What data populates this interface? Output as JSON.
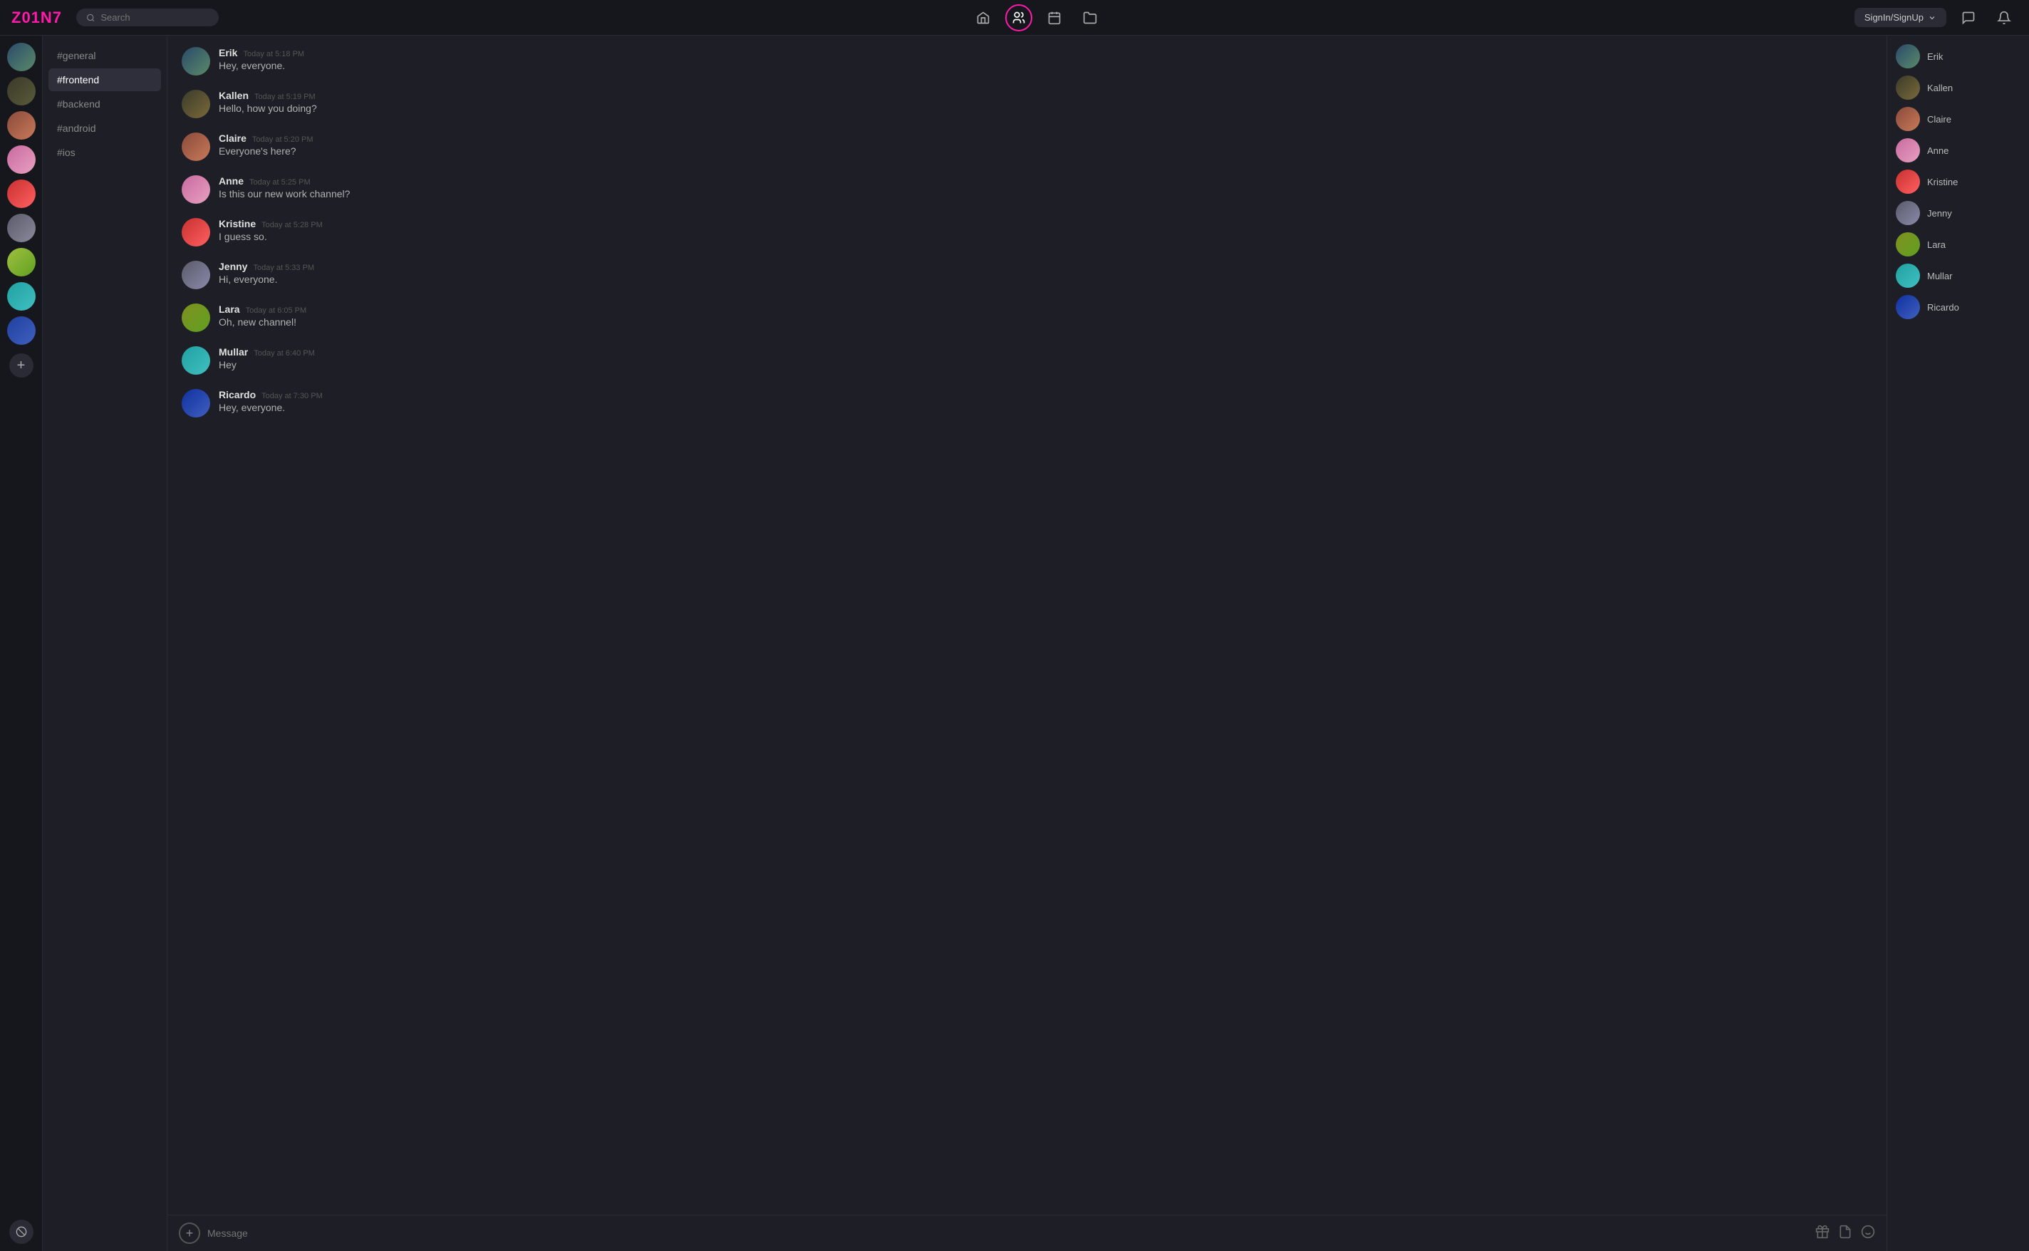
{
  "app": {
    "logo": "Z01N7",
    "search_placeholder": "Search"
  },
  "topnav": {
    "icons": [
      {
        "name": "home-icon",
        "symbol": "⌂",
        "label": "Home"
      },
      {
        "name": "people-icon",
        "symbol": "👥",
        "label": "People",
        "active": true
      },
      {
        "name": "calendar-icon",
        "symbol": "📅",
        "label": "Calendar"
      },
      {
        "name": "folder-icon",
        "symbol": "📁",
        "label": "Folder"
      }
    ],
    "signin_label": "SignIn/SignUp",
    "chat_icon": "💬",
    "bell_icon": "🔔"
  },
  "channels": {
    "items": [
      {
        "id": "general",
        "label": "#general",
        "active": false
      },
      {
        "id": "frontend",
        "label": "#frontend",
        "active": true
      },
      {
        "id": "backend",
        "label": "#backend",
        "active": false
      },
      {
        "id": "android",
        "label": "#android",
        "active": false
      },
      {
        "id": "ios",
        "label": "#ios",
        "active": false
      }
    ]
  },
  "messages": [
    {
      "id": "msg1",
      "user": "Erik",
      "time": "Today at 5:18 PM",
      "text": "Hey, everyone.",
      "avatar_class": "av-landscape"
    },
    {
      "id": "msg2",
      "user": "Kallen",
      "time": "Today at 5:19 PM",
      "text": "Hello, how you doing?",
      "avatar_class": "av-snake"
    },
    {
      "id": "msg3",
      "user": "Claire",
      "time": "Today at 5:20 PM",
      "text": "Everyone's here?",
      "avatar_class": "av-face"
    },
    {
      "id": "msg4",
      "user": "Anne",
      "time": "Today at 5:25 PM",
      "text": "Is this our new work channel?",
      "avatar_class": "av-flower"
    },
    {
      "id": "msg5",
      "user": "Kristine",
      "time": "Today at 5:28 PM",
      "text": "I guess so.",
      "avatar_class": "av-fire"
    },
    {
      "id": "msg6",
      "user": "Jenny",
      "time": "Today at 5:33 PM",
      "text": "Hi, everyone.",
      "avatar_class": "av-smoke"
    },
    {
      "id": "msg7",
      "user": "Lara",
      "time": "Today at 6:05 PM",
      "text": "Oh, new channel!",
      "avatar_class": "av-bird"
    },
    {
      "id": "msg8",
      "user": "Mullar",
      "time": "Today at 6:40 PM",
      "text": "Hey",
      "avatar_class": "av-teal"
    },
    {
      "id": "msg9",
      "user": "Ricardo",
      "time": "Today at 7:30 PM",
      "text": "Hey, everyone.",
      "avatar_class": "av-blue"
    }
  ],
  "members": [
    {
      "name": "Erik",
      "avatar_class": "av-landscape"
    },
    {
      "name": "Kallen",
      "avatar_class": "av-snake"
    },
    {
      "name": "Claire",
      "avatar_class": "av-face"
    },
    {
      "name": "Anne",
      "avatar_class": "av-flower"
    },
    {
      "name": "Kristine",
      "avatar_class": "av-fire"
    },
    {
      "name": "Jenny",
      "avatar_class": "av-smoke"
    },
    {
      "name": "Lara",
      "avatar_class": "av-bird"
    },
    {
      "name": "Mullar",
      "avatar_class": "av-teal"
    },
    {
      "name": "Ricardo",
      "avatar_class": "av-blue"
    }
  ],
  "chat_input": {
    "placeholder": "Message"
  }
}
